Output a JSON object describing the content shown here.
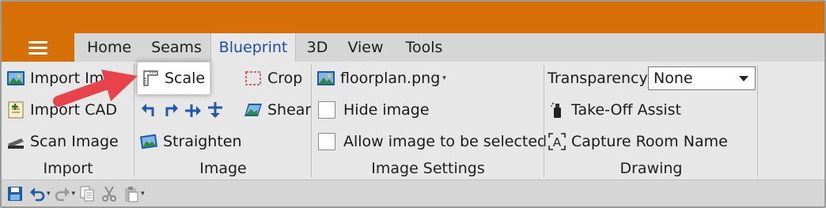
{
  "tabs": [
    {
      "label": "Home",
      "active": false
    },
    {
      "label": "Seams",
      "active": false
    },
    {
      "label": "Blueprint",
      "active": true
    },
    {
      "label": "3D",
      "active": false
    },
    {
      "label": "View",
      "active": false
    },
    {
      "label": "Tools",
      "active": false
    }
  ],
  "groups": {
    "import": {
      "label": "Import",
      "import_image": "Import Im",
      "import_cad": "Import CAD",
      "scan_image": "Scan Image"
    },
    "image": {
      "label": "Image",
      "scale": "Scale",
      "crop": "Crop",
      "shear": "Shear",
      "straighten": "Straighten"
    },
    "image_settings": {
      "label": "Image Settings",
      "file": "floorplan.png",
      "hide_image": "Hide image",
      "hide_image_checked": false,
      "allow_select": "Allow image to be selected",
      "allow_select_checked": false
    },
    "drawing": {
      "label": "Drawing",
      "transparency_label": "Transparency",
      "transparency_value": "None",
      "takeoff_assist": "Take-Off Assist",
      "capture_room_name": "Capture Room Name"
    }
  },
  "colors": {
    "titlebar": "#d56f06",
    "active_tab_text": "#1c4fa0",
    "callout_arrow": "#e8434a"
  }
}
